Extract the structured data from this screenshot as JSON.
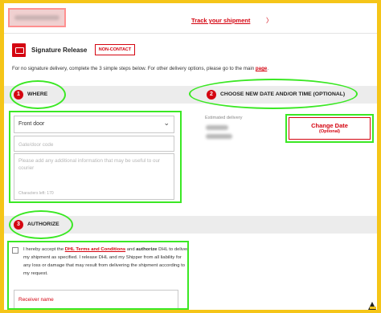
{
  "header": {
    "track_link": "Track your shipment",
    "track_chevron": "〉"
  },
  "signature": {
    "title": "Signature Release",
    "badge": "NON-CONTACT",
    "intro_prefix": "For no signature delivery, complete the 3 simple steps below. For other delivery options, please go to the main ",
    "intro_link": "page",
    "intro_suffix": "."
  },
  "steps": {
    "where": {
      "number": "1",
      "label": "WHERE"
    },
    "change": {
      "number": "2",
      "label": "CHOOSE NEW DATE AND/OR TIME (OPTIONAL)"
    },
    "authorize": {
      "number": "3",
      "label": "AUTHORIZE"
    }
  },
  "where": {
    "location_value": "Front door",
    "gate_placeholder": "Gate/door code",
    "info_placeholder": "Please add any additional information that may be useful to our courier",
    "char_count": "Characters left: 170"
  },
  "delivery": {
    "estimated_label": "Estimated delivery",
    "change_label": "Change Date",
    "change_sub": "(Optional)"
  },
  "authorize": {
    "text_1": "I hereby accept the ",
    "terms_link": "DHL Terms and Conditions",
    "text_2": " and ",
    "authorize_word": "authorize",
    "text_3": " DHL to deliver my shipment as specified. I release DHL and my Shipper from all liability for any loss or damage that may result from delivering the shipment according to my request.",
    "receiver_placeholder": "Receiver name"
  },
  "colors": {
    "brand_red": "#d40511",
    "brand_yellow": "#f5c518",
    "highlight_green": "#3be824"
  },
  "icons": {
    "signature": "signature-package-icon",
    "dropdown": "chevron-down-icon",
    "logo": "corner-logo-icon"
  }
}
